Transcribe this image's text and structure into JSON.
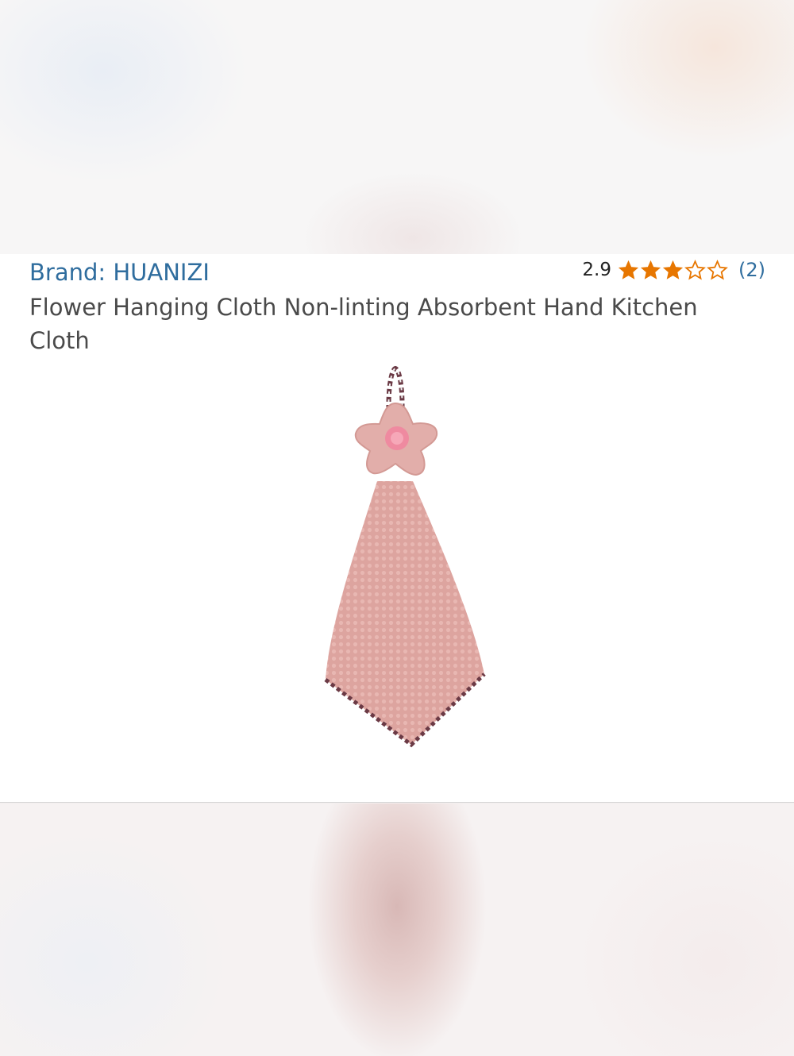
{
  "product": {
    "brand_label": "Brand: HUANIZI",
    "title": "Flower Hanging Cloth Non-linting Absorbent Hand Kitchen Cloth",
    "rating": {
      "value_text": "2.9",
      "value": 2.9,
      "max": 5,
      "review_count_text": "(2)",
      "star_color": "#e77600"
    },
    "image": {
      "subject": "pink-flower-hanging-towel"
    }
  },
  "colors": {
    "link": "#2f6d9e",
    "title_text": "#4a4a4a",
    "towel_pink": "#dfa7a2",
    "trim": "#6b3a45"
  }
}
